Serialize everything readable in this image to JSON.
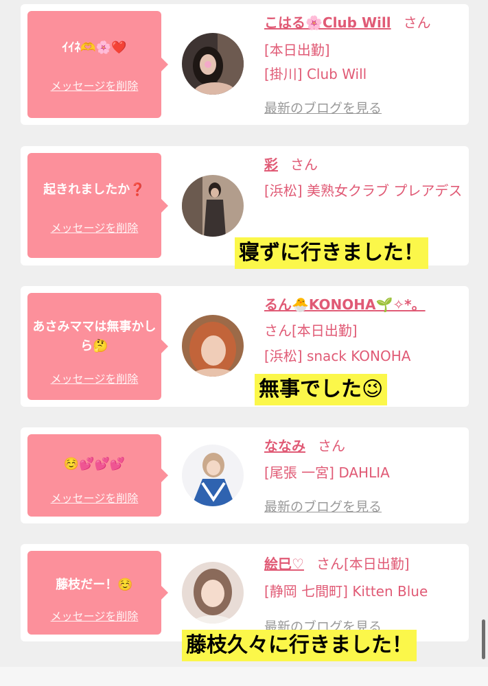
{
  "delete_label": "メッセージを削除",
  "san_label": "さん",
  "blog_label": "最新のブログを見る",
  "cards": [
    {
      "message": "ｲｲﾈ🫶🌸❤️",
      "name": "こはる🌸Club Will",
      "status": "[本日出勤]",
      "store": "[掛川] Club Will",
      "avatar_color": "#7a5d52"
    },
    {
      "message": "起きれましたか❓",
      "name": "彩",
      "store": "[浜松] 美熟女クラブ プレアデス",
      "avatar_color": "#5b4a44",
      "note": "寝ずに行きました！"
    },
    {
      "message": "あさみママは無事かしら🤔",
      "name": "るん🐣KONOHA🌱✧*。",
      "status": "[本日出勤]",
      "store": "[浜松] snack KONOHA",
      "avatar_color": "#c07a4a",
      "note": "無事でした😉"
    },
    {
      "message": "☺️💕💕💕",
      "name": "ななみ",
      "store": "[尾張 一宮] DAHLIA",
      "avatar_color": "#6f9cc8"
    },
    {
      "message": "藤枝だー！☺️",
      "name": "絵巳♡",
      "status": "[本日出勤]",
      "store": "[静岡 七間町] Kitten Blue",
      "avatar_color": "#b89a8a",
      "note": "藤枝久々に行きました！"
    }
  ]
}
